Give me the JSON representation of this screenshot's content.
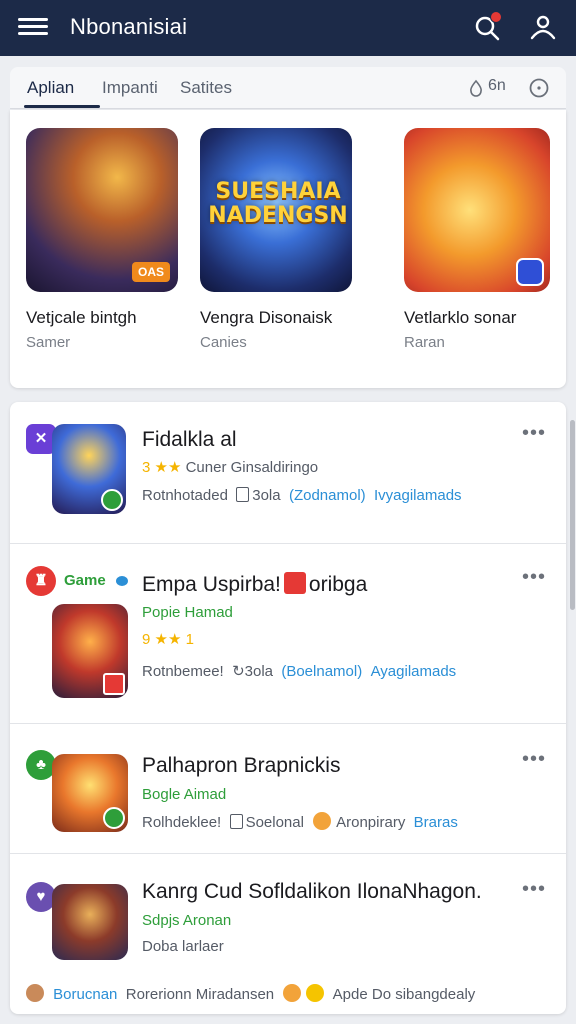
{
  "appbar": {
    "title": "Nbonanisiai",
    "menu_icon": "menu-icon",
    "search_icon": "search-icon",
    "account_icon": "person-icon"
  },
  "tabs": [
    {
      "label": "Aplian",
      "active": true
    },
    {
      "label": "Impanti",
      "active": false
    },
    {
      "label": "Satites",
      "active": false
    }
  ],
  "tabs_right": {
    "label": "6n"
  },
  "featured": [
    {
      "name": "Vetjcale bintgh",
      "category": "Samer",
      "tag": "OAS"
    },
    {
      "name": "Vengra Disonaisk",
      "category": "Canies",
      "art_text": "SUESHAIA NADENGSN"
    },
    {
      "name": "Vetlarklo sonar",
      "category": "Raran"
    }
  ],
  "list": [
    {
      "title": "Fidalkla al",
      "line2_stars": "3 ★★",
      "line2_text": "Cuner Ginsaldiringo",
      "line3_a": "Rotnhotaded",
      "line3_b": "3ola",
      "line3_c": "(Zodnamol)",
      "line3_d": "Ivyagilamads",
      "publisher_color": "#6a3fd6"
    },
    {
      "publisher_label": "Game",
      "title_a": "Empa Uspirba!",
      "title_b": "oribga",
      "line2_text": "Popie Hamad",
      "line3_stars": "9 ★★ 1",
      "line4_a": "Rotnbemee!",
      "line4_b": "3ola",
      "line4_c": "(Boelnamol)",
      "line4_d": "Ayagilamads",
      "publisher_color": "#e53935"
    },
    {
      "title": "Palhapron Brapnickis",
      "line2_text": "Bogle Aimad",
      "line3_a": "Rolhdeklee!",
      "line3_b": "Soelonal",
      "line3_c": "Aronpirary",
      "line3_d": "Braras",
      "publisher_color": "#2e9e3a"
    },
    {
      "title": "Kanrg Cud Sofldalikon IlonaNhagon.",
      "line2_text": "Sdpjs Aronan",
      "line3_text": "Doba larlaer",
      "publisher_color": "#6a4fb0"
    }
  ],
  "footer": {
    "a": "Borucnan",
    "b": "Rorerionn Miradansen",
    "c": "Apde Do sibangdealy"
  }
}
